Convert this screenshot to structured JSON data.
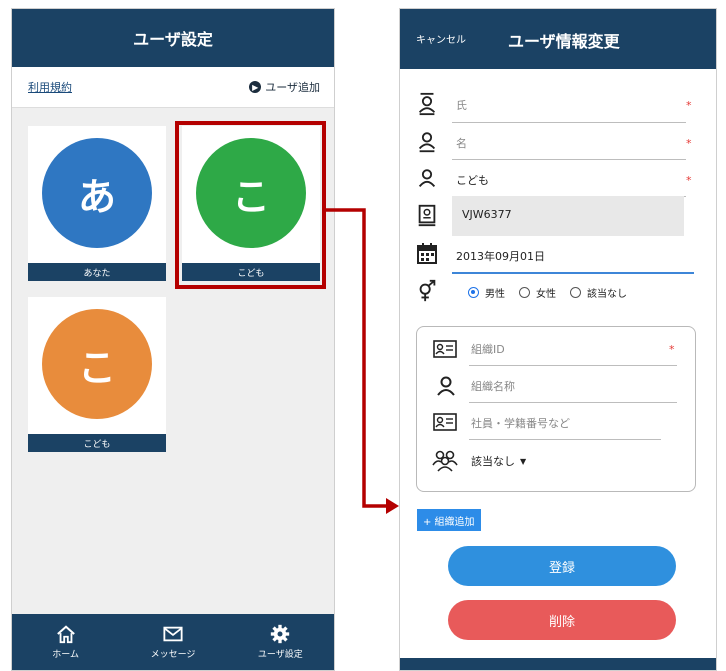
{
  "left": {
    "header_title": "ユーザ設定",
    "terms_link": "利用規約",
    "add_user": "ユーザ追加",
    "users": [
      {
        "avatar_char": "あ",
        "name": "あなた",
        "color": "#2f77c2"
      },
      {
        "avatar_char": "こ",
        "name": "こども",
        "color": "#2ea947"
      },
      {
        "avatar_char": "こ",
        "name": "こども",
        "color": "#e88c3c"
      }
    ],
    "tabs": [
      {
        "label": "ホーム",
        "icon": "home-icon"
      },
      {
        "label": "メッセージ",
        "icon": "envelope-icon"
      },
      {
        "label": "ユーザ設定",
        "icon": "gear-icon"
      }
    ]
  },
  "right": {
    "cancel": "キャンセル",
    "title": "ユーザ情報変更",
    "fields": {
      "last_name_placeholder": "氏",
      "first_name_placeholder": "名",
      "nickname": "こども",
      "user_id": "VJW6377",
      "birthdate": "2013年09月01日",
      "required_mark": "*"
    },
    "gender": {
      "options": [
        "男性",
        "女性",
        "該当なし"
      ],
      "selected": "男性"
    },
    "organization": {
      "org_id_placeholder": "組織ID",
      "org_name_placeholder": "組織名称",
      "member_no_placeholder": "社員・学籍番号など",
      "relation_value": "該当なし"
    },
    "add_org": "+ 組織追加",
    "register": "登録",
    "delete": "削除"
  },
  "colors": {
    "navy": "#1b4264",
    "highlight": "#b40000",
    "primary": "#2f90de",
    "danger": "#e85a5a"
  }
}
